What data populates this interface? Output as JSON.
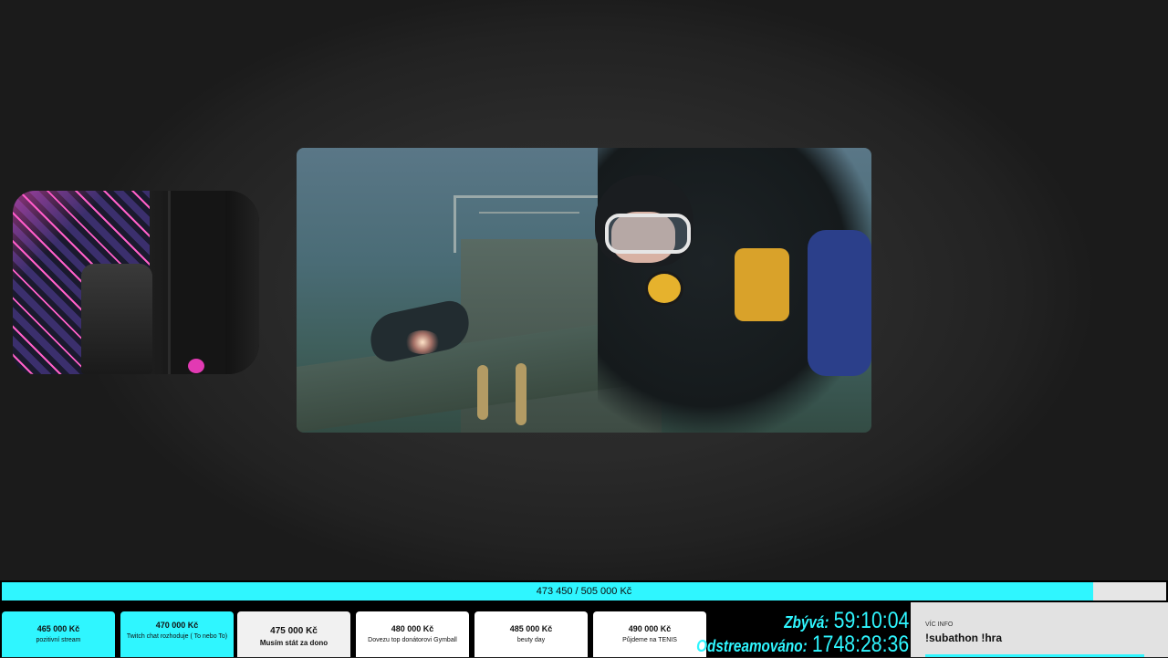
{
  "goal_progress": {
    "text": "473 450 / 505 000 Kč",
    "fraction": 0.9375
  },
  "goals": [
    {
      "amount": "465 000 Kč",
      "label": "pozitivní stream",
      "state": "done"
    },
    {
      "amount": "470 000 Kč",
      "label": "Twitch chat rozhoduje ( To nebo To)",
      "state": "done"
    },
    {
      "amount": "475 000 Kč",
      "label": "Musím stát za dono",
      "state": "current"
    },
    {
      "amount": "480 000 Kč",
      "label": "Dovezu top donátorovi Gymball",
      "state": "todo"
    },
    {
      "amount": "485 000 Kč",
      "label": "beuty day",
      "state": "todo"
    },
    {
      "amount": "490 000 Kč",
      "label": "Půjdeme na TENIS",
      "state": "todo"
    }
  ],
  "timers": {
    "remaining_label": "Zbývá:",
    "remaining_value": "59:10:04",
    "streamed_label": "Odstreamováno:",
    "streamed_value": "1748:28:36"
  },
  "info": {
    "caption": "VÍC INFO",
    "command": "!subathon !hra"
  },
  "colors": {
    "accent": "#2ff6ff",
    "background": "#1f1f1f",
    "panel": "#e2e2e2"
  }
}
